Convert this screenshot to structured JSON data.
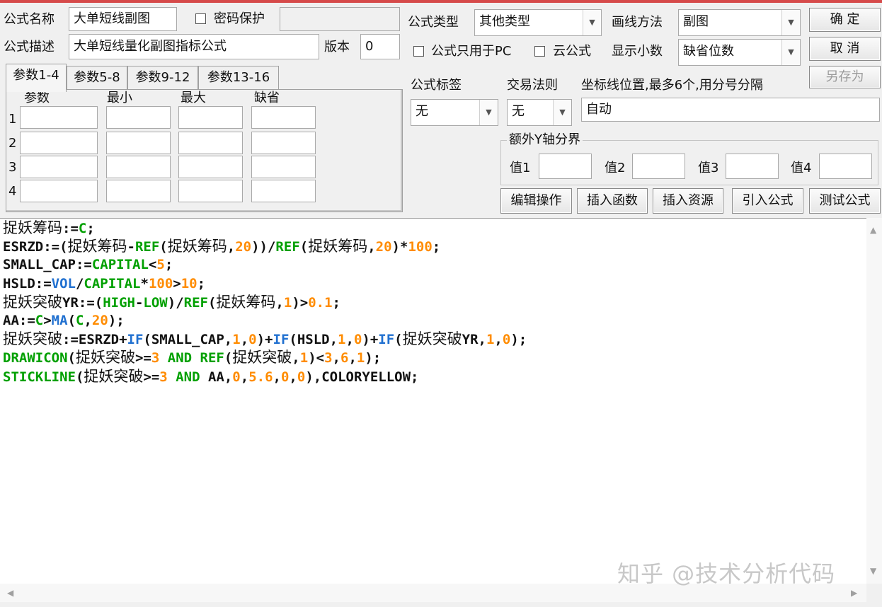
{
  "labels": {
    "formula_name": "公式名称",
    "password_protect": "密码保护",
    "formula_desc": "公式描述",
    "version": "版本",
    "formula_type": "公式类型",
    "draw_method": "画线方法",
    "pc_only": "公式只用于PC",
    "cloud_formula": "云公式",
    "show_decimals": "显示小数",
    "formula_tag": "公式标签",
    "trade_rule": "交易法则",
    "axis_position": "坐标线位置,最多6个,用分号分隔",
    "extra_y": "额外Y轴分界",
    "val1": "值1",
    "val2": "值2",
    "val3": "值3",
    "val4": "值4"
  },
  "fields": {
    "formula_name": "大单短线副图",
    "password": "",
    "formula_desc": "大单短线量化副图指标公式",
    "version": "0",
    "formula_type": "其他类型",
    "draw_method": "副图",
    "show_decimals": "缺省位数",
    "formula_tag": "无",
    "trade_rule": "无",
    "axis_position": "自动"
  },
  "buttons": {
    "ok": "确 定",
    "cancel": "取 消",
    "save_as": "另存为",
    "edit_op": "编辑操作",
    "insert_func": "插入函数",
    "insert_res": "插入资源",
    "import_formula": "引入公式",
    "test_formula": "测试公式"
  },
  "tabs": [
    "参数1-4",
    "参数5-8",
    "参数9-12",
    "参数13-16"
  ],
  "param_headers": [
    "参数",
    "最小",
    "最大",
    "缺省"
  ],
  "param_rows": [
    "1",
    "2",
    "3",
    "4"
  ],
  "code": {
    "l1a": "捉妖筹码",
    "l1b": ":=",
    "l1c": "C",
    "l1d": ";",
    "l2a": "ESRZD:=(",
    "l2b": "捉妖筹码",
    "l2c": "-",
    "l2d": "REF",
    "l2e": "(",
    "l2f": "捉妖筹码",
    "l2g": ",",
    "l2h": "20",
    "l2i": "))/",
    "l2j": "REF",
    "l2k": "(",
    "l2l": "捉妖筹码",
    "l2m": ",",
    "l2n": "20",
    "l2o": ")*",
    "l2p": "100",
    "l2q": ";",
    "l3a": "SMALL_CAP:=",
    "l3b": "CAPITAL",
    "l3c": "<",
    "l3d": "5",
    "l3e": ";",
    "l4a": "HSLD:=",
    "l4b": "VOL",
    "l4c": "/",
    "l4d": "CAPITAL",
    "l4e": "*",
    "l4f": "100",
    "l4g": ">",
    "l4h": "10",
    "l4i": ";",
    "l5a": "捉妖突破",
    "l5b": "YR:=(",
    "l5c": "HIGH",
    "l5d": "-",
    "l5e": "LOW",
    "l5f": ")/",
    "l5g": "REF",
    "l5h": "(",
    "l5i": "捉妖筹码",
    "l5j": ",",
    "l5k": "1",
    "l5l": ")>",
    "l5m": "0.1",
    "l5n": ";",
    "l6a": "AA:=",
    "l6b": "C",
    "l6c": ">",
    "l6d": "MA",
    "l6e": "(",
    "l6f": "C",
    "l6g": ",",
    "l6h": "20",
    "l6i": ");",
    "l7a": "捉妖突破",
    "l7b": ":=ESRZD+",
    "l7c": "IF",
    "l7d": "(SMALL_CAP,",
    "l7e": "1",
    "l7f": ",",
    "l7g": "0",
    "l7h": ")+",
    "l7i": "IF",
    "l7j": "(HSLD,",
    "l7k": "1",
    "l7l": ",",
    "l7m": "0",
    "l7n": ")+",
    "l7o": "IF",
    "l7p": "(",
    "l7q": "捉妖突破",
    "l7r": "YR,",
    "l7s": "1",
    "l7t": ",",
    "l7u": "0",
    "l7v": ");",
    "l8a": "DRAWICON",
    "l8b": "(",
    "l8c": "捉妖突破",
    "l8d": ">=",
    "l8e": "3",
    "l8f": " AND ",
    "l8g": "REF",
    "l8h": "(",
    "l8i": "捉妖突破",
    "l8j": ",",
    "l8k": "1",
    "l8l": ")<",
    "l8m": "3",
    "l8n": ",",
    "l8o": "6",
    "l8p": ",",
    "l8q": "1",
    "l8r": ");",
    "l9a": "STICKLINE",
    "l9b": "(",
    "l9c": "捉妖突破",
    "l9d": ">=",
    "l9e": "3",
    "l9f": " AND ",
    "l9g": "AA,",
    "l9h": "0",
    "l9i": ",",
    "l9j": "5.6",
    "l9k": ",",
    "l9l": "0",
    "l9m": ",",
    "l9n": "0",
    "l9o": "),COLORYELLOW;"
  },
  "watermark": "知乎 @技术分析代码",
  "colors": {
    "keyword_green": "#00a000",
    "number_orange": "#ff8c00",
    "function_blue": "#2070d0",
    "text_dark": "#111111"
  }
}
